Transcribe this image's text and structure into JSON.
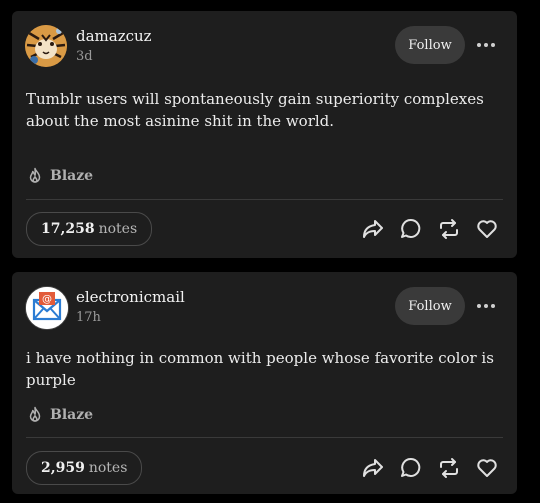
{
  "posts": [
    {
      "username": "damazcuz",
      "timestamp": "3d",
      "follow_label": "Follow",
      "body": "Tumblr users will spontaneously gain superiority complexes about the most asinine shit in the world.",
      "blaze_label": "Blaze",
      "notes_count": "17,258",
      "notes_label": "notes",
      "avatar_icon": "tiger-avatar"
    },
    {
      "username": "electronicmail",
      "timestamp": "17h",
      "follow_label": "Follow",
      "body": "i have nothing in common with people whose favorite color is purple",
      "blaze_label": "Blaze",
      "notes_count": "2,959",
      "notes_label": "notes",
      "avatar_icon": "email-envelope-avatar"
    }
  ],
  "colors": {
    "background": "#000000",
    "card": "#1e1e1e",
    "follow_button": "#3a3a3a",
    "email_accent": "#e25b3a",
    "email_blue": "#2b7cd3"
  },
  "icons": [
    "more-options-icon",
    "flame-icon",
    "share-icon",
    "reply-icon",
    "reblog-icon",
    "heart-icon"
  ]
}
